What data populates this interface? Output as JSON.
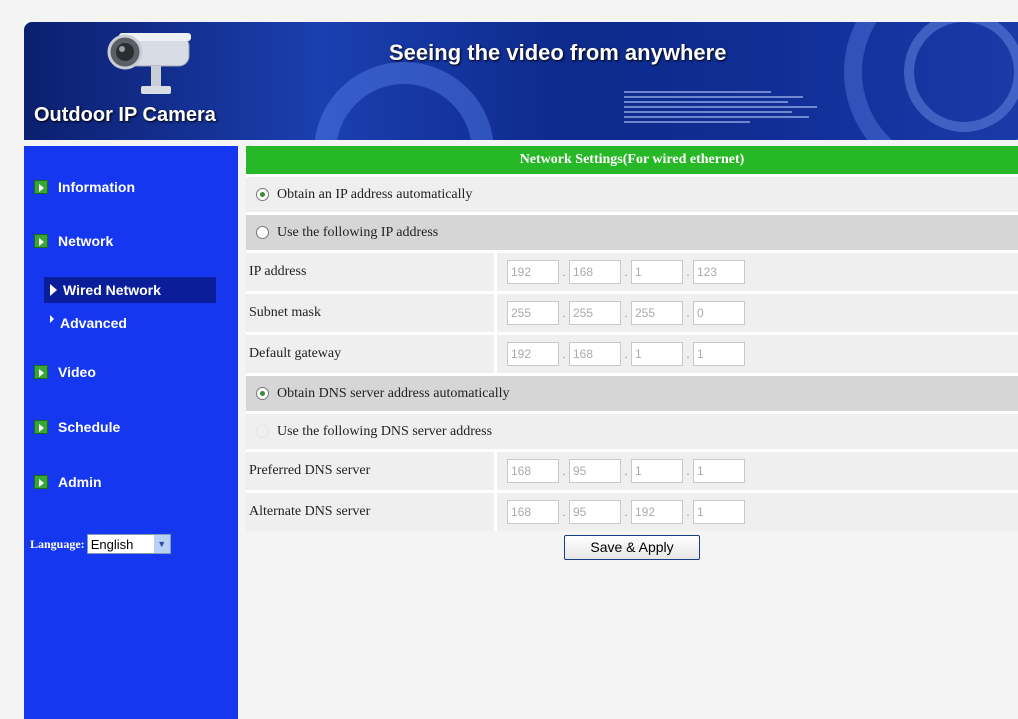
{
  "header": {
    "brand": "Outdoor IP Camera",
    "tagline": "Seeing the video from anywhere"
  },
  "sidebar": {
    "items": [
      {
        "label": "Information"
      },
      {
        "label": "Network"
      },
      {
        "label": "Video"
      },
      {
        "label": "Schedule"
      },
      {
        "label": "Admin"
      }
    ],
    "network_sub": [
      {
        "label": "Wired Network",
        "active": true
      },
      {
        "label": "Advanced",
        "active": false
      }
    ],
    "language_label": "Language:",
    "language_value": "English"
  },
  "main": {
    "title": "Network Settings(For wired ethernet)",
    "obtain_ip_auto": "Obtain an IP address automatically",
    "use_following_ip": "Use the following IP address",
    "ip_address_label": "IP address",
    "ip_address": [
      "192",
      "168",
      "1",
      "123"
    ],
    "subnet_label": "Subnet mask",
    "subnet": [
      "255",
      "255",
      "255",
      "0"
    ],
    "gateway_label": "Default gateway",
    "gateway": [
      "192",
      "168",
      "1",
      "1"
    ],
    "obtain_dns_auto": "Obtain DNS server address automatically",
    "use_following_dns": "Use the following DNS server address",
    "preferred_dns_label": "Preferred DNS server",
    "preferred_dns": [
      "168",
      "95",
      "1",
      "1"
    ],
    "alternate_dns_label": "Alternate DNS server",
    "alternate_dns": [
      "168",
      "95",
      "192",
      "1"
    ],
    "save_button": "Save & Apply"
  },
  "colors": {
    "sidebar": "#1637f0",
    "title_bar": "#27b827",
    "banner": "#0d2a8c"
  }
}
